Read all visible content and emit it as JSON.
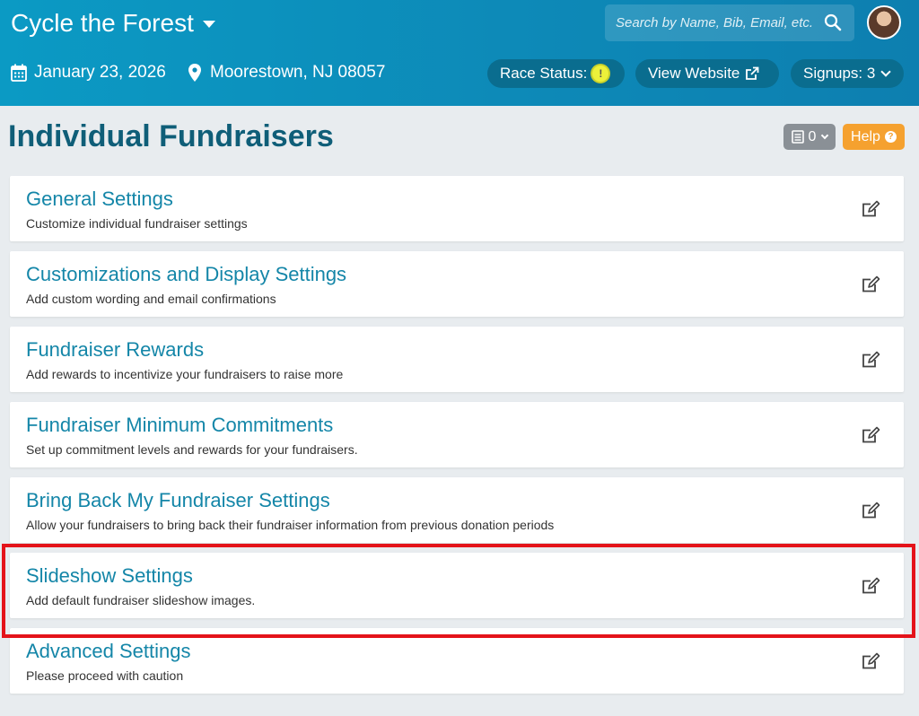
{
  "header": {
    "race_title": "Cycle the Forest",
    "search_placeholder": "Search by Name, Bib, Email, etc.",
    "date": "January 23, 2026",
    "location": "Moorestown, NJ 08057",
    "race_status_label": "Race Status:",
    "race_status_indicator": "!",
    "view_website_label": "View Website",
    "signups_label": "Signups: 3"
  },
  "page": {
    "title": "Individual Fundraisers",
    "notes_count": "0",
    "help_label": "Help"
  },
  "sections": [
    {
      "title": "General Settings",
      "description": "Customize individual fundraiser settings"
    },
    {
      "title": "Customizations and Display Settings",
      "description": "Add custom wording and email confirmations"
    },
    {
      "title": "Fundraiser Rewards",
      "description": "Add rewards to incentivize your fundraisers to raise more"
    },
    {
      "title": "Fundraiser Minimum Commitments",
      "description": "Set up commitment levels and rewards for your fundraisers."
    },
    {
      "title": "Bring Back My Fundraiser Settings",
      "description": "Allow your fundraisers to bring back their fundraiser information from previous donation periods"
    },
    {
      "title": "Slideshow Settings",
      "description": "Add default fundraiser slideshow images."
    },
    {
      "title": "Advanced Settings",
      "description": "Please proceed with caution"
    }
  ],
  "colors": {
    "header_bg": "#0d8ab8",
    "accent_title": "#1486a8",
    "help_orange": "#f5a12f",
    "highlight_red": "#e4131a"
  }
}
